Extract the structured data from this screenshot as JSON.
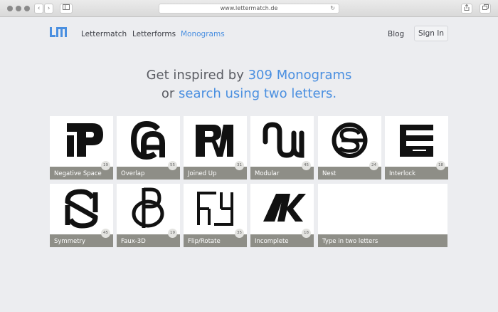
{
  "browser": {
    "url": "www.lettermatch.de"
  },
  "nav": {
    "items": [
      "Lettermatch",
      "Letterforms",
      "Monograms"
    ],
    "active_index": 2,
    "blog": "Blog",
    "signin": "Sign In"
  },
  "hero": {
    "line1_prefix": "Get inspired by ",
    "line1_link": "309 Monograms",
    "line2_prefix": "or ",
    "line2_link": "search using two letters."
  },
  "categories": [
    {
      "label": "Negative Space",
      "count": "19",
      "icon": "monogram-tp-icon"
    },
    {
      "label": "Overlap",
      "count": "55",
      "icon": "monogram-ca-icon"
    },
    {
      "label": "Joined Up",
      "count": "31",
      "icon": "monogram-rm-icon"
    },
    {
      "label": "Modular",
      "count": "45",
      "icon": "monogram-nu-icon"
    },
    {
      "label": "Nest",
      "count": "24",
      "icon": "monogram-se-icon"
    },
    {
      "label": "Interlock",
      "count": "18",
      "icon": "monogram-ee-icon"
    },
    {
      "label": "Symmetry",
      "count": "45",
      "icon": "monogram-sn-icon"
    },
    {
      "label": "Faux-3D",
      "count": "19",
      "icon": "monogram-op-icon"
    },
    {
      "label": "Flip/Rotate",
      "count": "35",
      "icon": "monogram-ff-icon"
    },
    {
      "label": "Incomplete",
      "count": "18",
      "icon": "monogram-ak-icon"
    }
  ],
  "search_tile": {
    "label": "Type in two letters"
  },
  "colors": {
    "accent": "#4a8fe0",
    "label_bar": "#8e8e87",
    "background": "#ecedf0"
  }
}
